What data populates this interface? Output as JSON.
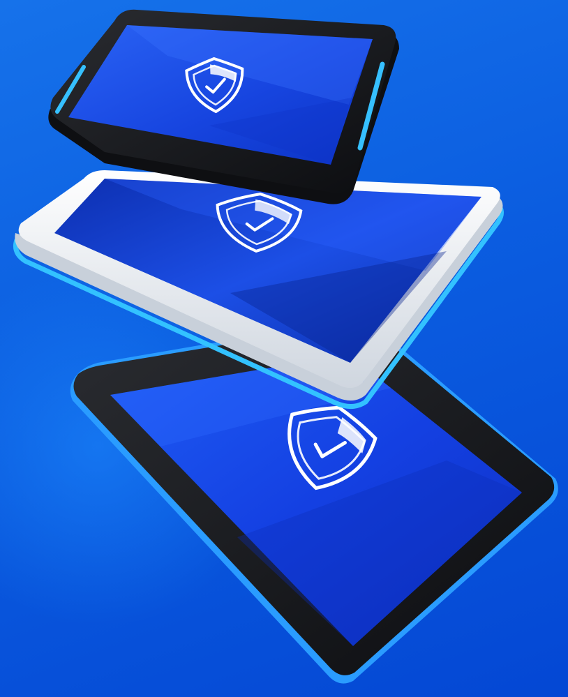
{
  "scene": {
    "description_free": true,
    "colors": {
      "background_top": "#1672ea",
      "background_bottom": "#0447d4",
      "screen_light": "#1f56f0",
      "screen_dark": "#0a2fb8",
      "bezel_black": "#141518",
      "bezel_white": "#e9edf2",
      "led_accent": "#2fb8ff",
      "shield_stroke": "#ffffff"
    },
    "devices": [
      {
        "name": "top-tablet",
        "bezel": "black",
        "icon": "shield-check-icon"
      },
      {
        "name": "middle-tablet",
        "bezel": "white",
        "icon": "shield-check-icon"
      },
      {
        "name": "bottom-tablet",
        "bezel": "black",
        "icon": "shield-check-icon"
      }
    ]
  }
}
